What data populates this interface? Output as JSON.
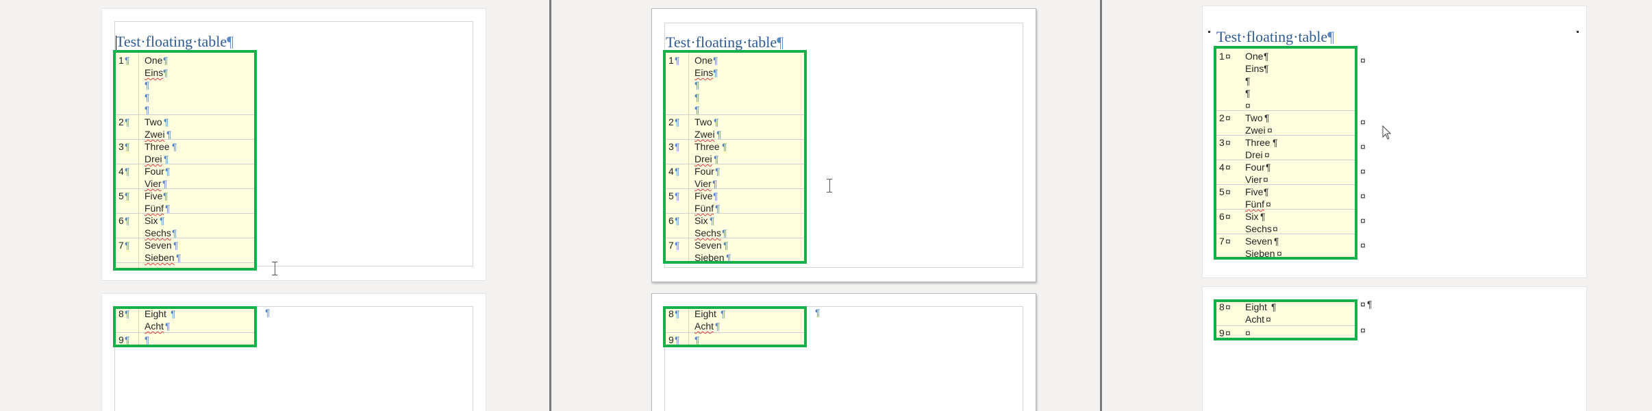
{
  "document": {
    "title": "Test·floating·table"
  },
  "marks": {
    "pilcrow": "¶",
    "cell_end": "¤"
  },
  "rows": [
    {
      "num": "1",
      "texts": [
        "One",
        "Eins",
        "",
        "",
        ""
      ]
    },
    {
      "num": "2",
      "texts": [
        "Two",
        "Zwei"
      ]
    },
    {
      "num": "3",
      "texts": [
        "Three",
        "Drei"
      ]
    },
    {
      "num": "4",
      "texts": [
        "Four",
        "Vier"
      ]
    },
    {
      "num": "5",
      "texts": [
        "Five",
        "Fünf"
      ]
    },
    {
      "num": "6",
      "texts": [
        "Six",
        "Sechs"
      ]
    },
    {
      "num": "7",
      "texts": [
        "Seven",
        "Sieben"
      ]
    }
  ],
  "rows_continued": [
    {
      "num": "8",
      "texts": [
        "Eight",
        "Acht"
      ]
    },
    {
      "num": "9",
      "texts": [
        ""
      ]
    }
  ]
}
